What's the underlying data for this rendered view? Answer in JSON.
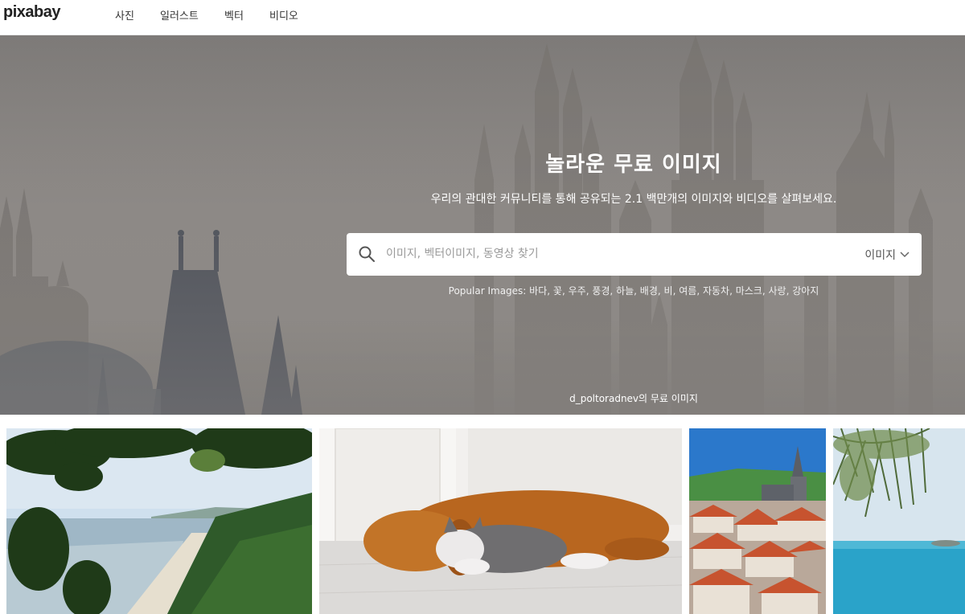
{
  "header": {
    "logo": "pixabay",
    "nav": [
      {
        "label": "사진"
      },
      {
        "label": "일러스트"
      },
      {
        "label": "벡터"
      },
      {
        "label": "비디오"
      }
    ]
  },
  "hero": {
    "title": "놀라운 무료 이미지",
    "subtitle": "우리의 관대한 커뮤니티를 통해 공유되는 2.1 백만개의 이미지와 비디오를 살펴보세요.",
    "search": {
      "placeholder": "이미지, 벡터이미지, 동영상 찾기",
      "value": "",
      "type_selected": "이미지"
    },
    "popular_label": "Popular Images:",
    "popular_tags": [
      "바다",
      "꽃",
      "우주",
      "풍경",
      "하늘",
      "배경",
      "비",
      "여름",
      "자동차",
      "마스크",
      "사랑",
      "강아지"
    ],
    "credit": "d_poltoradnev의 무료 이미지"
  },
  "gallery": [
    {
      "name": "coast-forest-photo"
    },
    {
      "name": "dog-and-cat-photo"
    },
    {
      "name": "old-town-photo"
    },
    {
      "name": "sea-branch-photo"
    }
  ],
  "colors": {
    "hero_fog": "#8c8885",
    "header_bg": "#ffffff",
    "text_white": "#ffffff"
  }
}
